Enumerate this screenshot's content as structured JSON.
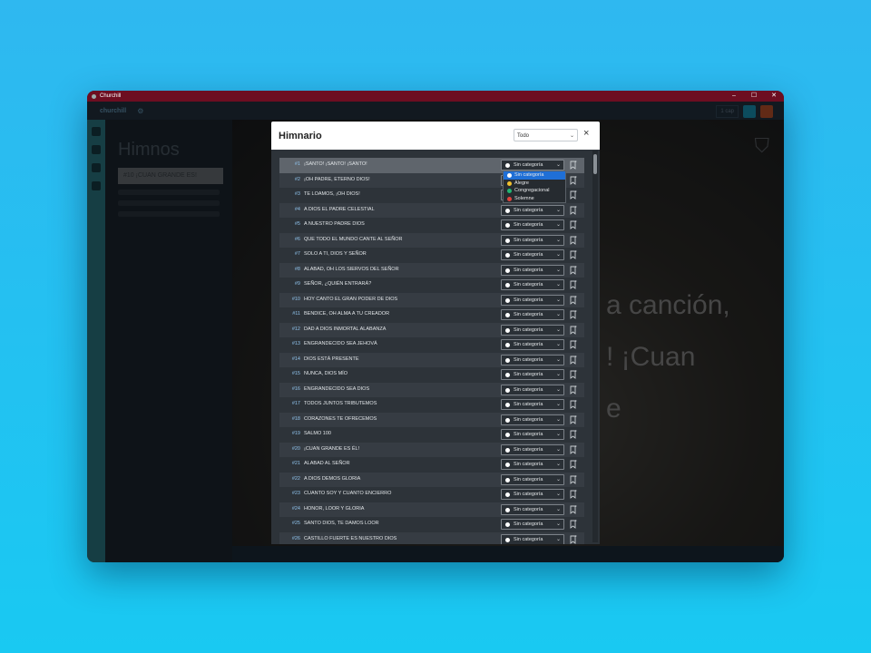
{
  "window": {
    "title": "Churchill",
    "controls": [
      "–",
      "☐",
      "✕"
    ]
  },
  "toolbar": {
    "logo": "churchill",
    "right_box": "1 cap"
  },
  "left_panel": {
    "title": "Himnos",
    "search_value": "#10 ¡CUAN GRANDE ES!"
  },
  "stage": {
    "lyric_lines": [
      "a canción,",
      "! ¡Cuan",
      "e"
    ]
  },
  "modal": {
    "title": "Himnario",
    "filter_value": "Todo",
    "close": "×",
    "default_category": "Sin categoría",
    "dropdown_options": [
      {
        "label": "Sin categoría",
        "color": "#ffffff"
      },
      {
        "label": "Alegre",
        "color": "#f2c12e"
      },
      {
        "label": "Congregacional",
        "color": "#22b573"
      },
      {
        "label": "Solemne",
        "color": "#e0433c"
      }
    ],
    "hymns": [
      {
        "num": "#1",
        "name": "¡SANTO! ¡SANTO! ¡SANTO!"
      },
      {
        "num": "#2",
        "name": "¡OH PADRE, ETERNO DIOS!"
      },
      {
        "num": "#3",
        "name": "TE LOAMOS, ¡OH DIOS!"
      },
      {
        "num": "#4",
        "name": "A DIOS EL PADRE CELESTIAL"
      },
      {
        "num": "#5",
        "name": "A NUESTRO PADRE DIOS"
      },
      {
        "num": "#6",
        "name": "QUE TODO EL MUNDO CANTE AL SEÑOR"
      },
      {
        "num": "#7",
        "name": "SOLO A TI, DIOS Y SEÑOR"
      },
      {
        "num": "#8",
        "name": "ALABAD, OH LOS SIERVOS DEL SEÑOR"
      },
      {
        "num": "#9",
        "name": "SEÑOR, ¿QUIÉN ENTRARÁ?"
      },
      {
        "num": "#10",
        "name": "HOY CANTO EL GRAN PODER DE DIOS"
      },
      {
        "num": "#11",
        "name": "BENDICE, OH ALMA A TU CREADOR"
      },
      {
        "num": "#12",
        "name": "DAD A DIOS INMORTAL ALABANZA"
      },
      {
        "num": "#13",
        "name": "ENGRANDECIDO SEA JEHOVÁ"
      },
      {
        "num": "#14",
        "name": "DIOS ESTÁ PRESENTE"
      },
      {
        "num": "#15",
        "name": "NUNCA, DIOS MÍO"
      },
      {
        "num": "#16",
        "name": "ENGRANDECIDO SEA DIOS"
      },
      {
        "num": "#17",
        "name": "TODOS JUNTOS TRIBUTEMOS"
      },
      {
        "num": "#18",
        "name": "CORAZONES TE OFRECEMOS"
      },
      {
        "num": "#19",
        "name": "SALMO 100"
      },
      {
        "num": "#20",
        "name": "¡CUAN GRANDE ES ÉL!"
      },
      {
        "num": "#21",
        "name": "ALABAD AL SEÑOR"
      },
      {
        "num": "#22",
        "name": "A DIOS DEMOS GLORIA"
      },
      {
        "num": "#23",
        "name": "CUANTO SOY Y CUANTO ENCIERRO"
      },
      {
        "num": "#24",
        "name": "HONOR, LOOR Y GLORIA"
      },
      {
        "num": "#25",
        "name": "SANTO DIOS, TE DAMOS LOOR"
      },
      {
        "num": "#26",
        "name": "CASTILLO FUERTE ES NUESTRO DIOS"
      }
    ]
  }
}
